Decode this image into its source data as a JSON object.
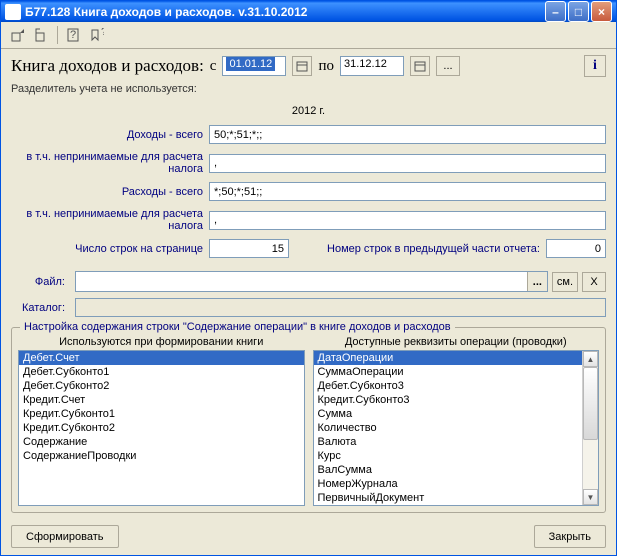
{
  "window": {
    "title": "Б77.128 Книга доходов и расходов. v.31.10.2012"
  },
  "header": {
    "title": "Книга доходов и расходов:",
    "from_label": "с",
    "to_label": "по",
    "date_from": "01.01.12",
    "date_to": "31.12.12",
    "ellipsis": "..."
  },
  "rows": {
    "separator_note": "Разделитель учета не используется:",
    "year": "2012 г.",
    "income_total_label": "Доходы - всего",
    "income_total": "50;*;51;*;;",
    "income_excl_label": "в т.ч. непринимаемые для расчета налога",
    "income_excl": ",",
    "expense_total_label": "Расходы - всего",
    "expense_total": "*;50;*;51;;",
    "expense_excl_label": "в т.ч. непринимаемые для расчета налога",
    "expense_excl": ",",
    "rows_per_page_label": "Число строк на странице",
    "rows_per_page": "15",
    "prev_rows_label": "Номер строк в предыдущей части отчета:",
    "prev_rows": "0",
    "file_label": "Файл:",
    "file_value": "",
    "file_browse": "...",
    "file_cm": "см.",
    "file_x": "X",
    "catalog_label": "Каталог:",
    "catalog_value": ""
  },
  "fieldset": {
    "legend": "Настройка содержания строки \"Содержание операции\" в книге доходов и расходов",
    "left_header": "Используются при формировании книги",
    "right_header": "Доступные реквизиты операции (проводки)",
    "left_items": [
      "Дебет.Счет",
      "Дебет.Субконто1",
      "Дебет.Субконто2",
      "Кредит.Счет",
      "Кредит.Субконто1",
      "Кредит.Субконто2",
      "Содержание",
      "СодержаниеПроводки"
    ],
    "right_items": [
      "ДатаОперации",
      "СуммаОперации",
      "Дебет.Субконто3",
      "Кредит.Субконто3",
      "Сумма",
      "Количество",
      "Валюта",
      "Курс",
      "ВалСумма",
      "НомерЖурнала",
      "ПервичныйДокумент"
    ]
  },
  "buttons": {
    "generate": "Сформировать",
    "close": "Закрыть"
  }
}
